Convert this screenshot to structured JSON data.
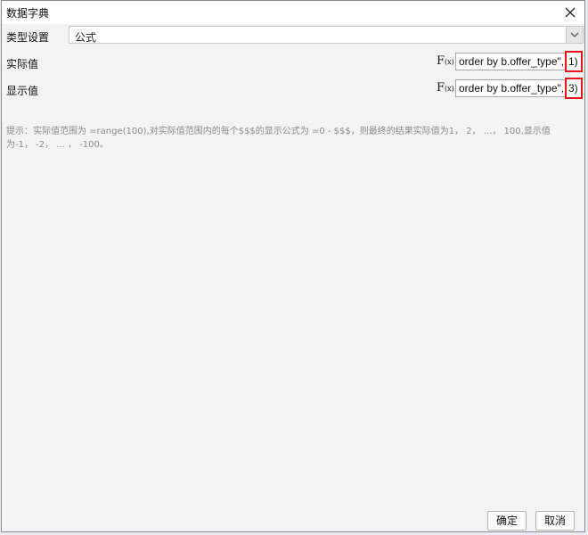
{
  "window": {
    "title": "数据字典"
  },
  "type_row": {
    "label": "类型设置",
    "selected_value": "公式"
  },
  "actual_row": {
    "label": "实际值",
    "formula_value": "order by b.offer_type\",",
    "highlighted_suffix": "1)"
  },
  "display_row": {
    "label": "显示值",
    "formula_value": "order by b.offer_type\",",
    "highlighted_suffix": "3)"
  },
  "fx_icon": {
    "main": "F",
    "sub": "(x)"
  },
  "hint": {
    "text": "提示：实际值范围为 =range(100),对实际值范围内的每个$$$的显示公式为 =0 - $$$，则最终的结果实际值为1， 2， ...， 100,显示值为-1， -2， ... ， -100。"
  },
  "buttons": {
    "ok_label": "确定",
    "cancel_label": "取消"
  },
  "colors": {
    "highlight_border": "#e8141a",
    "hint_text": "#8a8a8a"
  }
}
